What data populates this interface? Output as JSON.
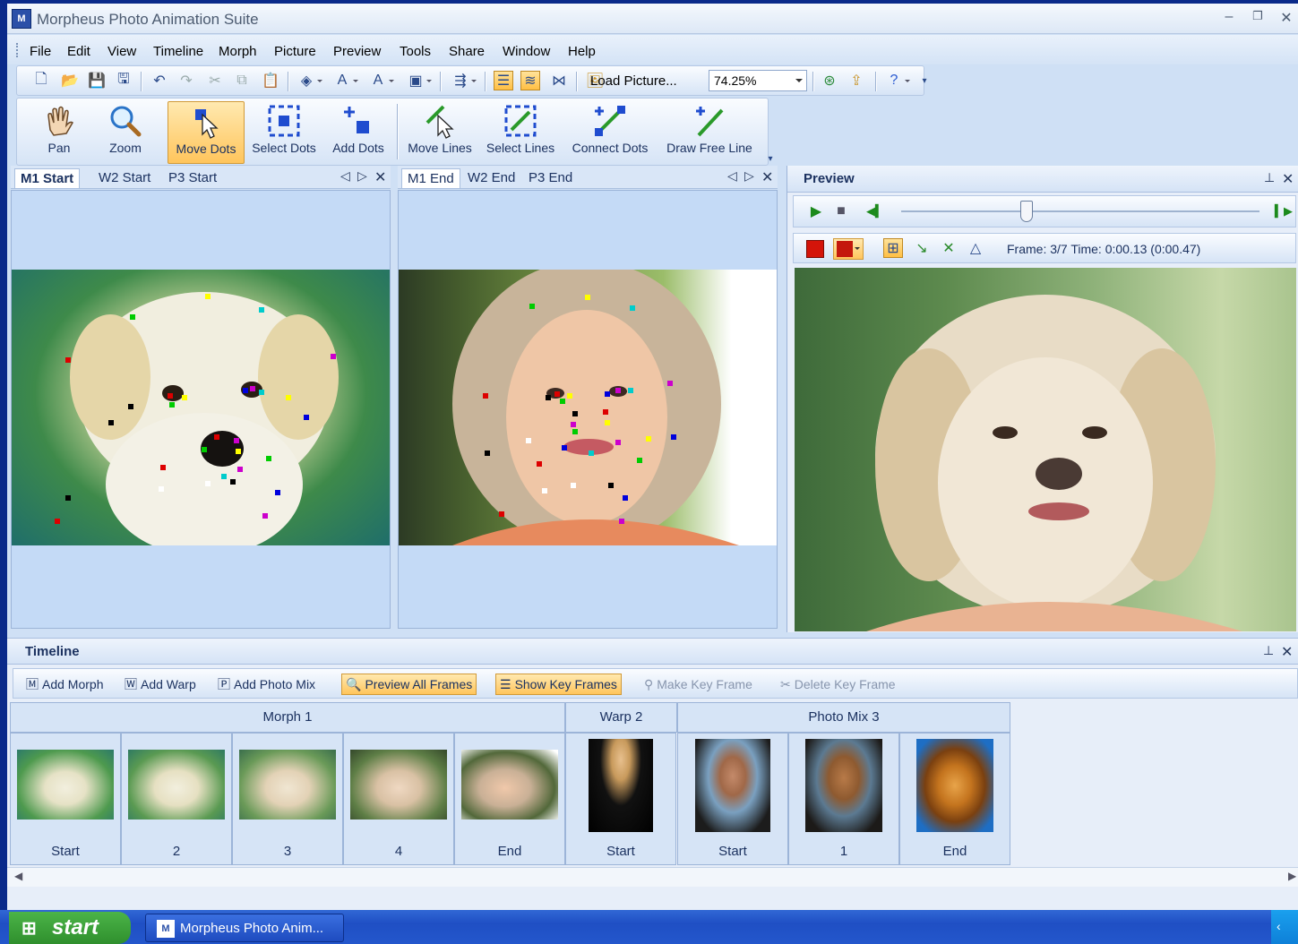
{
  "window": {
    "title": "Morpheus Photo Animation Suite",
    "icon_text": "M"
  },
  "menu": [
    "File",
    "Edit",
    "View",
    "Timeline",
    "Morph",
    "Picture",
    "Preview",
    "Tools",
    "Share",
    "Window",
    "Help"
  ],
  "toolbar": {
    "load_picture": "Load Picture...",
    "zoom": "74.25%"
  },
  "tools": [
    "Pan",
    "Zoom",
    "Move Dots",
    "Select Dots",
    "Add Dots",
    "Move Lines",
    "Select Lines",
    "Connect Dots",
    "Draw Free Line"
  ],
  "start_tabs": [
    "M1 Start",
    "W2 Start",
    "P3 Start"
  ],
  "end_tabs": [
    "M1 End",
    "W2 End",
    "P3 End"
  ],
  "preview": {
    "title": "Preview",
    "frame_info": "Frame: 3/7 Time: 0:00.13 (0:00.47)",
    "slider_fraction": 0.35
  },
  "timeline": {
    "title": "Timeline",
    "buttons": [
      "Add Morph",
      "Add Warp",
      "Add Photo Mix",
      "Preview All Frames",
      "Show Key Frames",
      "Make Key Frame",
      "Delete Key Frame"
    ],
    "groups": [
      "Morph 1",
      "Warp 2",
      "Photo Mix 3"
    ],
    "frames": [
      "Start",
      "2",
      "3",
      "4",
      "End",
      "Start",
      "Start",
      "1",
      "End"
    ]
  },
  "taskbar": {
    "start": "start",
    "item": "Morpheus Photo Anim..."
  }
}
